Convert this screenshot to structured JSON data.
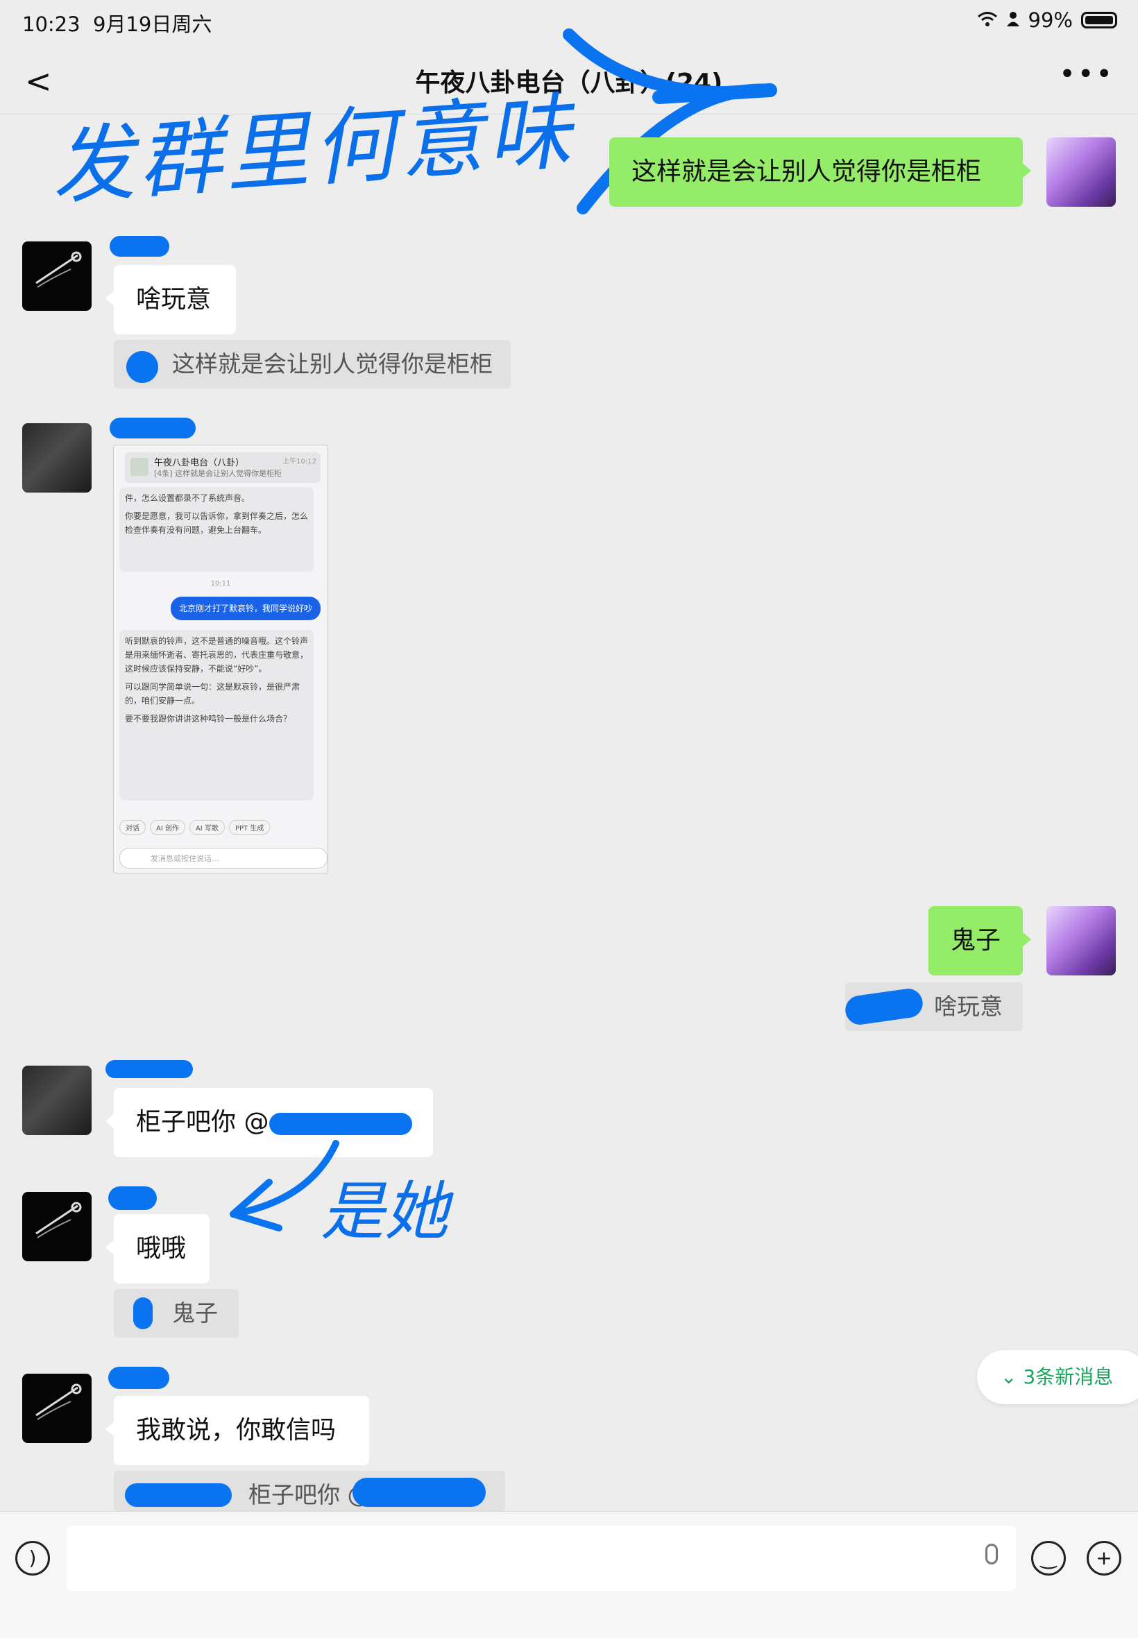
{
  "status": {
    "time": "10:23",
    "date": "9月19日周六",
    "battery": "99%"
  },
  "nav": {
    "back": "<",
    "title": "午夜八卦电台（八卦）(24)",
    "more": "•••"
  },
  "annotations": {
    "top": "发群里何意味",
    "arrow_note": "是她"
  },
  "messages": {
    "m1": {
      "text": "这样就是会让别人觉得你是柜柜"
    },
    "m2": {
      "text": "啥玩意",
      "quote": "这样就是会让别人觉得你是柜柜"
    },
    "m4": {
      "text": "鬼子",
      "quote": "啥玩意"
    },
    "m5": {
      "text": "柜子吧你 @"
    },
    "m6": {
      "text": "哦哦",
      "quote": "鬼子"
    },
    "m7": {
      "text": "我敢说，你敢信吗",
      "quote": "柜子吧你 @"
    }
  },
  "screenshot": {
    "header_title": "午夜八卦电台（八卦）",
    "header_sub": "[4条] 这样就是会让别人觉得你是柜柜",
    "header_time": "上午10:12",
    "p1": "件，怎么设置都录不了系统声音。",
    "p2": "你要是愿意，我可以告诉你，拿到伴奏之后，怎么检查伴奏有没有问题，避免上台翻车。",
    "timestamp": "10:11",
    "user_msg": "北京刚才打了默哀铃，我同学说好吵",
    "p3": "听到默哀的铃声，这不是普通的噪音哦。这个铃声是用来缅怀逝者、寄托哀思的，代表庄重与敬意，这时候应该保持安静，不能说“好吵”。",
    "p4": "可以跟同学简单说一句：这是默哀铃，是很严肃的，咱们安静一点。",
    "p5": "要不要我跟你讲讲这种鸣铃一般是什么场合？",
    "chips": [
      "对话",
      "AI 创作",
      "AI 写歌",
      "PPT 生成"
    ],
    "input_placeholder": "发消息或按住说话..."
  },
  "new_messages": "3条新消息",
  "colors": {
    "bubble_green": "#95ec69",
    "scribble_blue": "#0a74f0",
    "new_msg_green": "#17a55b"
  }
}
